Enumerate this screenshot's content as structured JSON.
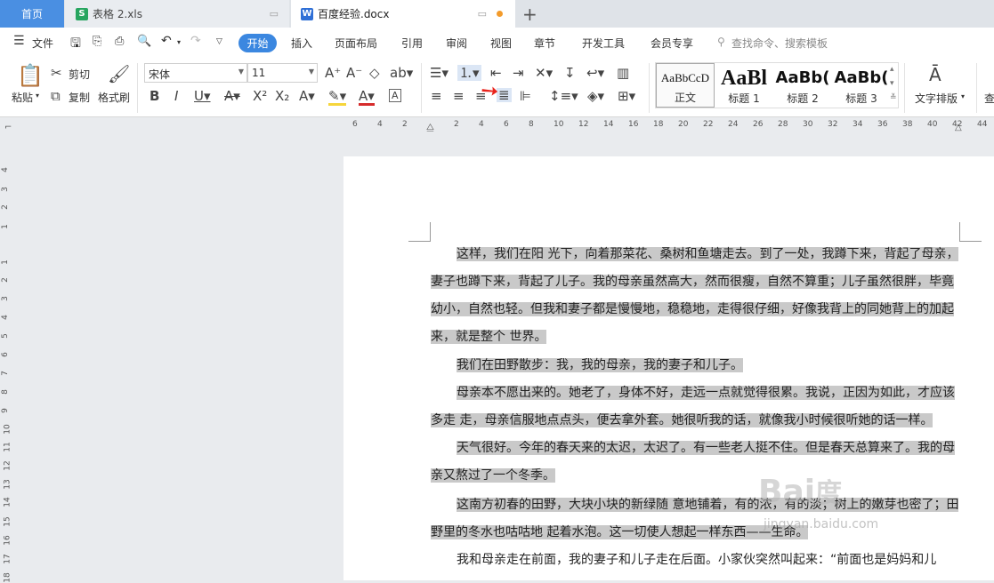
{
  "tabs": {
    "home": "首页",
    "xls": "表格 2.xls",
    "doc": "百度经验.docx",
    "xls_icon": "S",
    "doc_icon": "W"
  },
  "menu": {
    "file": "文件",
    "start": "开始",
    "insert": "插入",
    "layout": "页面布局",
    "reference": "引用",
    "review": "审阅",
    "view": "视图",
    "chapter": "章节",
    "dev": "开发工具",
    "member": "会员专享",
    "search": "查找命令、搜索模板"
  },
  "ribbon": {
    "paste": "粘贴",
    "cut": "剪切",
    "copy": "复制",
    "format_painter": "格式刷",
    "font_name": "宋体",
    "font_size": "11",
    "styles": [
      {
        "preview": "AaBbCcD",
        "label": "正文"
      },
      {
        "preview": "AaBl",
        "label": "标题 1"
      },
      {
        "preview": "AaBb(",
        "label": "标题 2"
      },
      {
        "preview": "AaBb(",
        "label": "标题 3"
      }
    ],
    "text_layout": "文字排版",
    "find": "查"
  },
  "ruler": {
    "h": [
      "6",
      "4",
      "2",
      "2",
      "4",
      "6",
      "8",
      "10",
      "12",
      "14",
      "16",
      "18",
      "20",
      "22",
      "24",
      "26",
      "28",
      "30",
      "32",
      "34",
      "36",
      "38",
      "40",
      "42",
      "44"
    ],
    "v": [
      "4",
      "3",
      "2",
      "1",
      "1",
      "2",
      "3",
      "4",
      "5",
      "6",
      "7",
      "8",
      "9",
      "10",
      "11",
      "12",
      "13",
      "14",
      "15",
      "16",
      "17",
      "18"
    ]
  },
  "document": {
    "paragraphs": [
      "这样，我们在阳 光下，向着那菜花、桑树和鱼塘走去。到了一处，我蹲下来，背起了母亲，妻子也蹲下来，背起了儿子。我的母亲虽然高大，然而很瘦，自然不算重；儿子虽然很胖，毕竟幼小，自然也轻。但我和妻子都是慢慢地，稳稳地，走得很仔细，好像我背上的同她背上的加起来，就是整个 世界。",
      "我们在田野散步：我，我的母亲，我的妻子和儿子。",
      "母亲本不愿出来的。她老了，身体不好，走远一点就觉得很累。我说，正因为如此，才应该多走 走，母亲信服地点点头，便去拿外套。她很听我的话，就像我小时候很听她的话一样。",
      "天气很好。今年的春天来的太迟，太迟了。有一些老人挺不住。但是春天总算来了。我的母亲又熬过了一个冬季。",
      "这南方初春的田野，大块小块的新绿随 意地铺着，有的浓，有的淡；树上的嫩芽也密了；田野里的冬水也咕咕地 起着水泡。这一切使人想起一样东西——生命。",
      "我和母亲走在前面，我的妻子和儿子走在后面。小家伙突然叫起来：“前面也是妈妈和儿"
    ]
  },
  "watermark": {
    "text": "Bai度",
    "sub": "jingyan.baidu.com"
  }
}
